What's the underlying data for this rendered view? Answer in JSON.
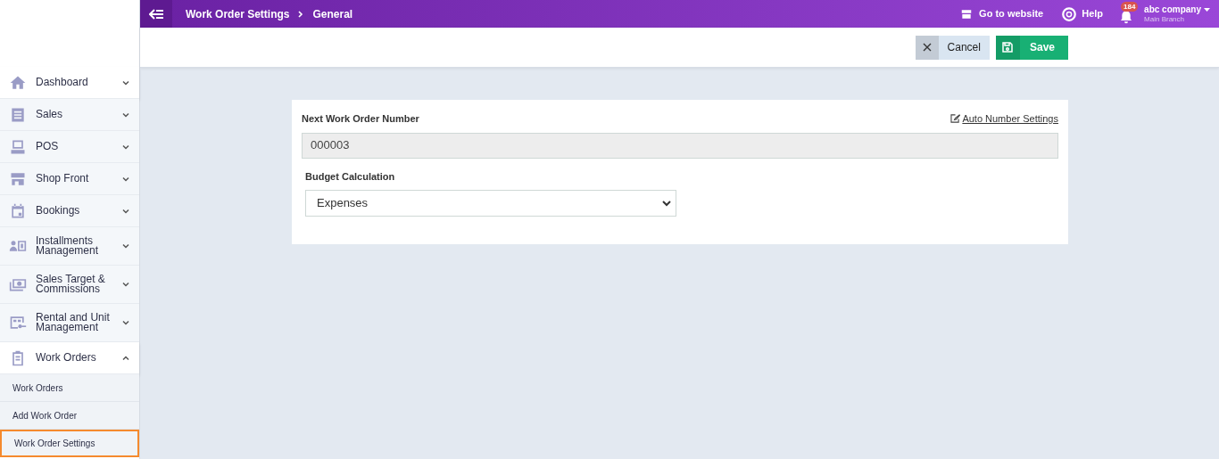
{
  "topbar": {
    "breadcrumb": [
      "Work Order Settings",
      "General"
    ],
    "go_to_website": "Go to website",
    "help": "Help",
    "notifications": "184",
    "company": "abc company",
    "branch": "Main Branch"
  },
  "actions": {
    "cancel": "Cancel",
    "save": "Save"
  },
  "sidebar": {
    "items": [
      {
        "label": "Dashboard",
        "expanded": false
      },
      {
        "label": "Sales",
        "expanded": false
      },
      {
        "label": "POS",
        "expanded": false
      },
      {
        "label": "Shop Front",
        "expanded": false
      },
      {
        "label": "Bookings",
        "expanded": false
      },
      {
        "label": "Installments Management",
        "expanded": false
      },
      {
        "label": "Sales Target & Commissions",
        "expanded": false
      },
      {
        "label": "Rental and Unit Management",
        "expanded": false
      },
      {
        "label": "Work Orders",
        "expanded": true,
        "children": [
          {
            "label": "Work Orders",
            "selected": false
          },
          {
            "label": "Add Work Order",
            "selected": false
          },
          {
            "label": "Work Order Settings",
            "selected": true
          }
        ]
      }
    ]
  },
  "form": {
    "next_number_label": "Next Work Order Number",
    "auto_number_link": "Auto Number Settings",
    "next_number_value": "000003",
    "budget_label": "Budget Calculation",
    "budget_value": "Expenses"
  }
}
